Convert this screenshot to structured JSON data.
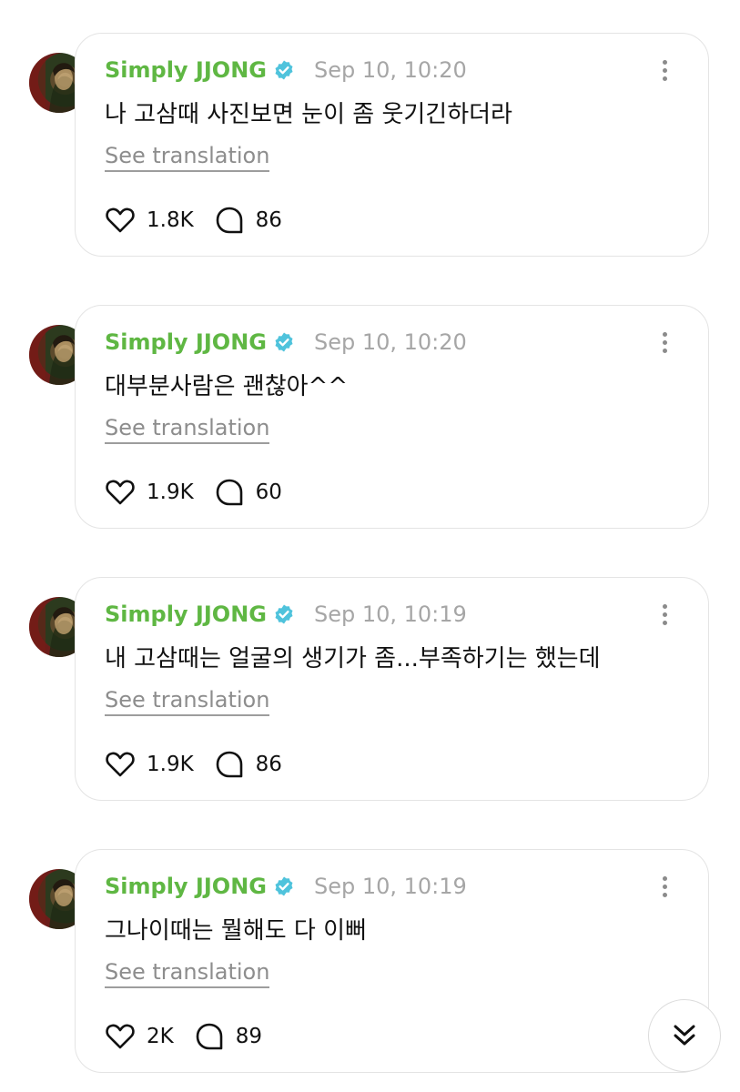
{
  "colors": {
    "username": "#5fb743",
    "verified": "#4fc3dc",
    "timestamp": "#a6a6a6",
    "translate_link": "#8d8d8d"
  },
  "posts": [
    {
      "username": "Simply JJONG",
      "verified_icon": "verified-badge-icon",
      "timestamp": "Sep 10, 10:20",
      "text": "나 고삼때 사진보면 눈이 좀 웃기긴하더라",
      "translate_label": "See translation",
      "likes": "1.8K",
      "replies": "86"
    },
    {
      "username": "Simply JJONG",
      "verified_icon": "verified-badge-icon",
      "timestamp": "Sep 10, 10:20",
      "text": "대부분사람은 괜찮아^^",
      "translate_label": "See translation",
      "likes": "1.9K",
      "replies": "60"
    },
    {
      "username": "Simply JJONG",
      "verified_icon": "verified-badge-icon",
      "timestamp": "Sep 10, 10:19",
      "text": "내 고삼때는 얼굴의 생기가 좀...부족하기는 했는데",
      "translate_label": "See translation",
      "likes": "1.9K",
      "replies": "86"
    },
    {
      "username": "Simply JJONG",
      "verified_icon": "verified-badge-icon",
      "timestamp": "Sep 10, 10:19",
      "text": "그나이때는 뭘해도 다 이뻐",
      "translate_label": "See translation",
      "likes": "2K",
      "replies": "89"
    }
  ],
  "scroll_button": {
    "icon": "double-chevron-down-icon"
  }
}
